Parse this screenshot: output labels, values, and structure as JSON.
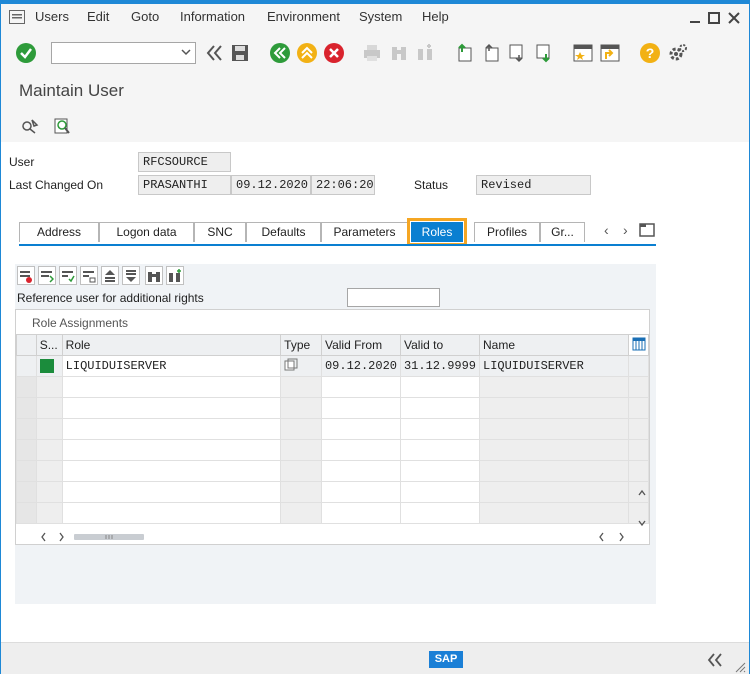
{
  "menu": {
    "items": [
      {
        "label": "Users"
      },
      {
        "label": "Edit"
      },
      {
        "label": "Goto"
      },
      {
        "label": "Information"
      },
      {
        "label": "Environment"
      },
      {
        "label": "System"
      },
      {
        "label": "Help"
      }
    ]
  },
  "colors": {
    "accent": "#0a7fd1",
    "highlight": "#f5a623",
    "confirm": "#2e9b3a",
    "cancel": "#d9232d",
    "nav": "#f2b114"
  },
  "page": {
    "title": "Maintain User"
  },
  "header": {
    "user_label": "User",
    "user_value": "RFCSOURCE",
    "changed_label": "Last Changed On",
    "changed_by": "PRASANTHI",
    "changed_date": "09.12.2020",
    "changed_time": "22:06:20",
    "status_label": "Status",
    "status_value": "Revised"
  },
  "tabs": [
    {
      "label": "Address"
    },
    {
      "label": "Logon data"
    },
    {
      "label": "SNC"
    },
    {
      "label": "Defaults"
    },
    {
      "label": "Parameters"
    },
    {
      "label": "Roles"
    },
    {
      "label": "Profiles"
    },
    {
      "label": "Gr..."
    }
  ],
  "roles": {
    "reference_label": "Reference user for additional rights",
    "reference_value": "",
    "grid_title": "Role Assignments",
    "columns": [
      "S...",
      "Role",
      "Type",
      "Valid From",
      "Valid to",
      "Name"
    ],
    "rows": [
      {
        "role": "LIQUIDUISERVER",
        "valid_from": "09.12.2020",
        "valid_to": "31.12.9999",
        "name": "LIQUIDUISERVER"
      }
    ]
  },
  "footer": {
    "logo": "SAP"
  }
}
